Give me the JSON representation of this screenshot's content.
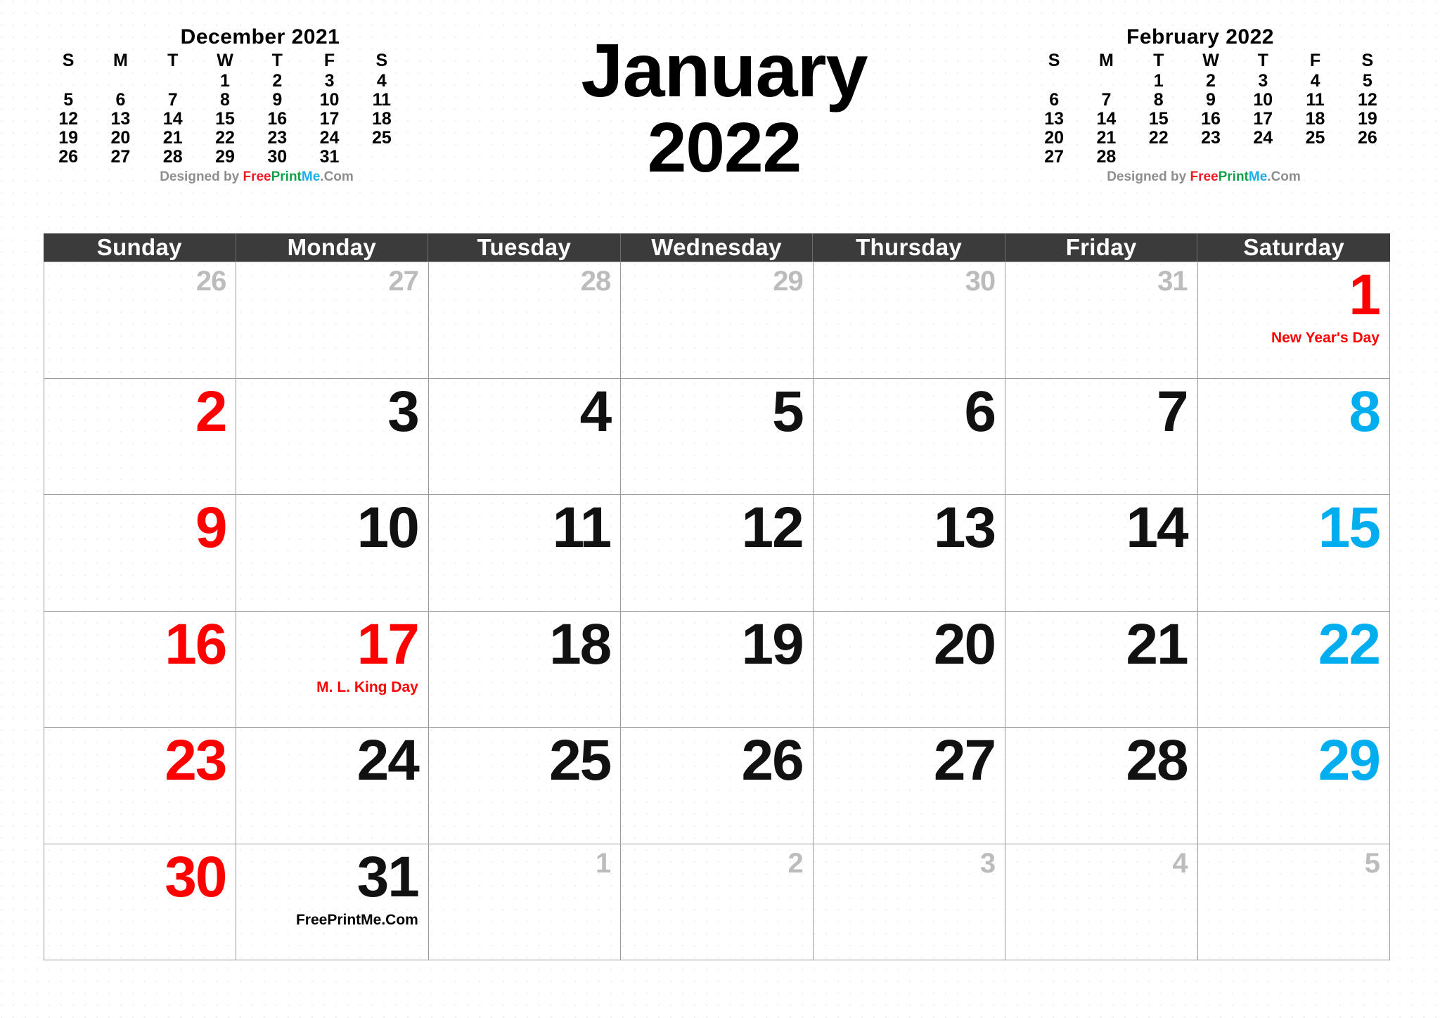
{
  "header": {
    "month_name": "January",
    "year": "2022"
  },
  "colors": {
    "sunday": "#FF0000",
    "saturday": "#00AEEF",
    "weekday": "#111111",
    "outside_month": "#BCBCBC",
    "header_band": "#3B3B3B",
    "header_text": "#FFFFFF",
    "holiday": "#FF0000",
    "grid_line": "#9B9B9B"
  },
  "credit": {
    "designed_by": "Designed by",
    "brand_free": "Free",
    "brand_print": "Print",
    "brand_me": "Me",
    "brand_com": ".Com"
  },
  "mini_calendars": [
    {
      "id": "december-2021",
      "title": "December  2021",
      "dow": [
        "S",
        "M",
        "T",
        "W",
        "T",
        "F",
        "S"
      ],
      "weeks": [
        [
          "",
          "",
          "",
          "1",
          "2",
          "3",
          "4"
        ],
        [
          "5",
          "6",
          "7",
          "8",
          "9",
          "10",
          "11"
        ],
        [
          "12",
          "13",
          "14",
          "15",
          "16",
          "17",
          "18"
        ],
        [
          "19",
          "20",
          "21",
          "22",
          "23",
          "24",
          "25"
        ],
        [
          "26",
          "27",
          "28",
          "29",
          "30",
          "31",
          ""
        ]
      ]
    },
    {
      "id": "february-2022",
      "title": "February  2022",
      "dow": [
        "S",
        "M",
        "T",
        "W",
        "T",
        "F",
        "S"
      ],
      "weeks": [
        [
          "",
          "",
          "1",
          "2",
          "3",
          "4",
          "5"
        ],
        [
          "6",
          "7",
          "8",
          "9",
          "10",
          "11",
          "12"
        ],
        [
          "13",
          "14",
          "15",
          "16",
          "17",
          "18",
          "19"
        ],
        [
          "20",
          "21",
          "22",
          "23",
          "24",
          "25",
          "26"
        ],
        [
          "27",
          "28",
          "",
          "",
          "",
          "",
          ""
        ]
      ]
    }
  ],
  "weekday_headers": [
    "Sunday",
    "Monday",
    "Tuesday",
    "Wednesday",
    "Thursday",
    "Friday",
    "Saturday"
  ],
  "weeks": [
    [
      {
        "num": "26",
        "type": "other",
        "col": "sun"
      },
      {
        "num": "27",
        "type": "other",
        "col": "mon"
      },
      {
        "num": "28",
        "type": "other",
        "col": "tue"
      },
      {
        "num": "29",
        "type": "other",
        "col": "wed"
      },
      {
        "num": "30",
        "type": "other",
        "col": "thu"
      },
      {
        "num": "31",
        "type": "other",
        "col": "fri"
      },
      {
        "num": "1",
        "type": "holiday",
        "col": "sat",
        "event": "New Year's Day"
      }
    ],
    [
      {
        "num": "2",
        "type": "sun",
        "col": "sun"
      },
      {
        "num": "3",
        "type": "day",
        "col": "mon"
      },
      {
        "num": "4",
        "type": "day",
        "col": "tue"
      },
      {
        "num": "5",
        "type": "day",
        "col": "wed"
      },
      {
        "num": "6",
        "type": "day",
        "col": "thu"
      },
      {
        "num": "7",
        "type": "day",
        "col": "fri"
      },
      {
        "num": "8",
        "type": "sat",
        "col": "sat"
      }
    ],
    [
      {
        "num": "9",
        "type": "sun",
        "col": "sun"
      },
      {
        "num": "10",
        "type": "day",
        "col": "mon"
      },
      {
        "num": "11",
        "type": "day",
        "col": "tue"
      },
      {
        "num": "12",
        "type": "day",
        "col": "wed"
      },
      {
        "num": "13",
        "type": "day",
        "col": "thu"
      },
      {
        "num": "14",
        "type": "day",
        "col": "fri"
      },
      {
        "num": "15",
        "type": "sat",
        "col": "sat"
      }
    ],
    [
      {
        "num": "16",
        "type": "sun",
        "col": "sun"
      },
      {
        "num": "17",
        "type": "holiday",
        "col": "mon",
        "event": "M. L. King Day"
      },
      {
        "num": "18",
        "type": "day",
        "col": "tue"
      },
      {
        "num": "19",
        "type": "day",
        "col": "wed"
      },
      {
        "num": "20",
        "type": "day",
        "col": "thu"
      },
      {
        "num": "21",
        "type": "day",
        "col": "fri"
      },
      {
        "num": "22",
        "type": "sat",
        "col": "sat"
      }
    ],
    [
      {
        "num": "23",
        "type": "sun",
        "col": "sun"
      },
      {
        "num": "24",
        "type": "day",
        "col": "mon"
      },
      {
        "num": "25",
        "type": "day",
        "col": "tue"
      },
      {
        "num": "26",
        "type": "day",
        "col": "wed"
      },
      {
        "num": "27",
        "type": "day",
        "col": "thu"
      },
      {
        "num": "28",
        "type": "day",
        "col": "fri"
      },
      {
        "num": "29",
        "type": "sat",
        "col": "sat"
      }
    ],
    [
      {
        "num": "30",
        "type": "sun",
        "col": "sun"
      },
      {
        "num": "31",
        "type": "day",
        "col": "mon",
        "brand": true
      },
      {
        "num": "1",
        "type": "other",
        "col": "tue"
      },
      {
        "num": "2",
        "type": "other",
        "col": "wed"
      },
      {
        "num": "3",
        "type": "other",
        "col": "thu"
      },
      {
        "num": "4",
        "type": "other",
        "col": "fri"
      },
      {
        "num": "5",
        "type": "other",
        "col": "sat"
      }
    ]
  ]
}
